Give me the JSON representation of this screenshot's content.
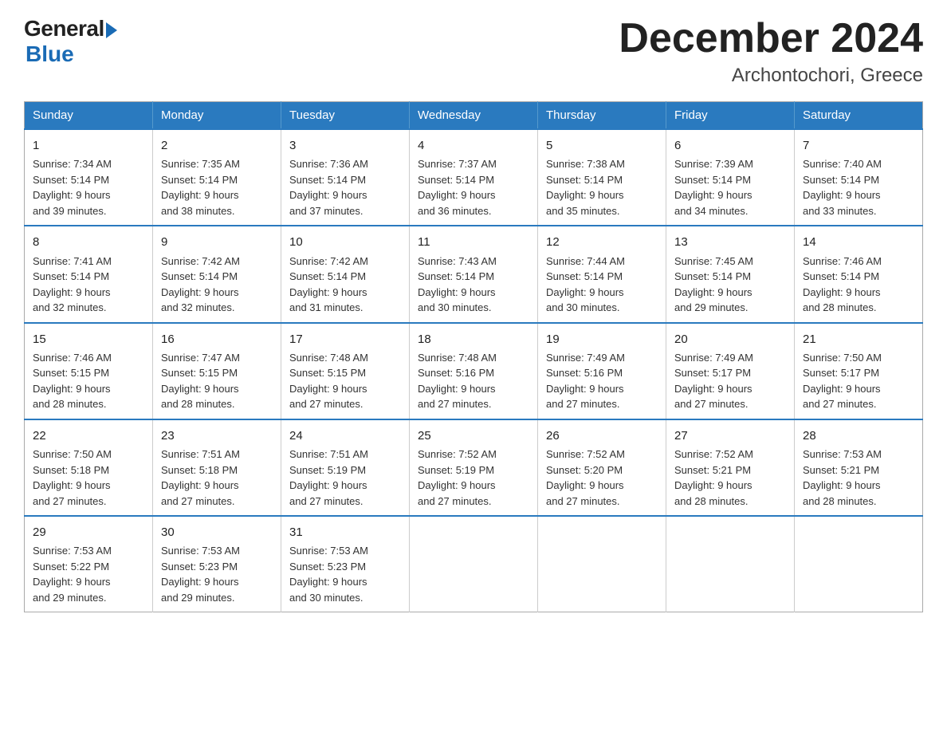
{
  "logo": {
    "general": "General",
    "blue": "Blue"
  },
  "title": "December 2024",
  "subtitle": "Archontochori, Greece",
  "days_of_week": [
    "Sunday",
    "Monday",
    "Tuesday",
    "Wednesday",
    "Thursday",
    "Friday",
    "Saturday"
  ],
  "weeks": [
    [
      {
        "day": "1",
        "sunrise": "7:34 AM",
        "sunset": "5:14 PM",
        "daylight": "9 hours and 39 minutes."
      },
      {
        "day": "2",
        "sunrise": "7:35 AM",
        "sunset": "5:14 PM",
        "daylight": "9 hours and 38 minutes."
      },
      {
        "day": "3",
        "sunrise": "7:36 AM",
        "sunset": "5:14 PM",
        "daylight": "9 hours and 37 minutes."
      },
      {
        "day": "4",
        "sunrise": "7:37 AM",
        "sunset": "5:14 PM",
        "daylight": "9 hours and 36 minutes."
      },
      {
        "day": "5",
        "sunrise": "7:38 AM",
        "sunset": "5:14 PM",
        "daylight": "9 hours and 35 minutes."
      },
      {
        "day": "6",
        "sunrise": "7:39 AM",
        "sunset": "5:14 PM",
        "daylight": "9 hours and 34 minutes."
      },
      {
        "day": "7",
        "sunrise": "7:40 AM",
        "sunset": "5:14 PM",
        "daylight": "9 hours and 33 minutes."
      }
    ],
    [
      {
        "day": "8",
        "sunrise": "7:41 AM",
        "sunset": "5:14 PM",
        "daylight": "9 hours and 32 minutes."
      },
      {
        "day": "9",
        "sunrise": "7:42 AM",
        "sunset": "5:14 PM",
        "daylight": "9 hours and 32 minutes."
      },
      {
        "day": "10",
        "sunrise": "7:42 AM",
        "sunset": "5:14 PM",
        "daylight": "9 hours and 31 minutes."
      },
      {
        "day": "11",
        "sunrise": "7:43 AM",
        "sunset": "5:14 PM",
        "daylight": "9 hours and 30 minutes."
      },
      {
        "day": "12",
        "sunrise": "7:44 AM",
        "sunset": "5:14 PM",
        "daylight": "9 hours and 30 minutes."
      },
      {
        "day": "13",
        "sunrise": "7:45 AM",
        "sunset": "5:14 PM",
        "daylight": "9 hours and 29 minutes."
      },
      {
        "day": "14",
        "sunrise": "7:46 AM",
        "sunset": "5:14 PM",
        "daylight": "9 hours and 28 minutes."
      }
    ],
    [
      {
        "day": "15",
        "sunrise": "7:46 AM",
        "sunset": "5:15 PM",
        "daylight": "9 hours and 28 minutes."
      },
      {
        "day": "16",
        "sunrise": "7:47 AM",
        "sunset": "5:15 PM",
        "daylight": "9 hours and 28 minutes."
      },
      {
        "day": "17",
        "sunrise": "7:48 AM",
        "sunset": "5:15 PM",
        "daylight": "9 hours and 27 minutes."
      },
      {
        "day": "18",
        "sunrise": "7:48 AM",
        "sunset": "5:16 PM",
        "daylight": "9 hours and 27 minutes."
      },
      {
        "day": "19",
        "sunrise": "7:49 AM",
        "sunset": "5:16 PM",
        "daylight": "9 hours and 27 minutes."
      },
      {
        "day": "20",
        "sunrise": "7:49 AM",
        "sunset": "5:17 PM",
        "daylight": "9 hours and 27 minutes."
      },
      {
        "day": "21",
        "sunrise": "7:50 AM",
        "sunset": "5:17 PM",
        "daylight": "9 hours and 27 minutes."
      }
    ],
    [
      {
        "day": "22",
        "sunrise": "7:50 AM",
        "sunset": "5:18 PM",
        "daylight": "9 hours and 27 minutes."
      },
      {
        "day": "23",
        "sunrise": "7:51 AM",
        "sunset": "5:18 PM",
        "daylight": "9 hours and 27 minutes."
      },
      {
        "day": "24",
        "sunrise": "7:51 AM",
        "sunset": "5:19 PM",
        "daylight": "9 hours and 27 minutes."
      },
      {
        "day": "25",
        "sunrise": "7:52 AM",
        "sunset": "5:19 PM",
        "daylight": "9 hours and 27 minutes."
      },
      {
        "day": "26",
        "sunrise": "7:52 AM",
        "sunset": "5:20 PM",
        "daylight": "9 hours and 27 minutes."
      },
      {
        "day": "27",
        "sunrise": "7:52 AM",
        "sunset": "5:21 PM",
        "daylight": "9 hours and 28 minutes."
      },
      {
        "day": "28",
        "sunrise": "7:53 AM",
        "sunset": "5:21 PM",
        "daylight": "9 hours and 28 minutes."
      }
    ],
    [
      {
        "day": "29",
        "sunrise": "7:53 AM",
        "sunset": "5:22 PM",
        "daylight": "9 hours and 29 minutes."
      },
      {
        "day": "30",
        "sunrise": "7:53 AM",
        "sunset": "5:23 PM",
        "daylight": "9 hours and 29 minutes."
      },
      {
        "day": "31",
        "sunrise": "7:53 AM",
        "sunset": "5:23 PM",
        "daylight": "9 hours and 30 minutes."
      },
      {
        "day": "",
        "sunrise": "",
        "sunset": "",
        "daylight": ""
      },
      {
        "day": "",
        "sunrise": "",
        "sunset": "",
        "daylight": ""
      },
      {
        "day": "",
        "sunrise": "",
        "sunset": "",
        "daylight": ""
      },
      {
        "day": "",
        "sunrise": "",
        "sunset": "",
        "daylight": ""
      }
    ]
  ],
  "labels": {
    "sunrise_prefix": "Sunrise: ",
    "sunset_prefix": "Sunset: ",
    "daylight_prefix": "Daylight: "
  }
}
